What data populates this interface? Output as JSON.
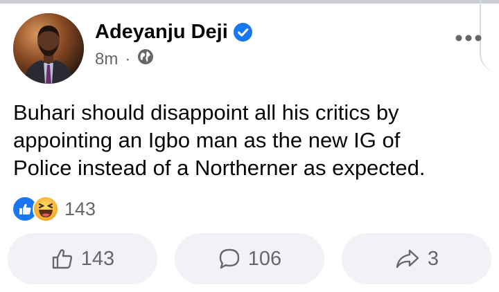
{
  "post": {
    "author": "Adeyanju Deji",
    "time": "8m",
    "separator": "·",
    "text": "Buhari should disappoint all his critics by\nappointing an Igbo man as the new IG of\nPolice instead of a Northerner as expected.",
    "reaction_count": "143",
    "reaction_icons": [
      "like-icon",
      "haha-icon"
    ]
  },
  "actions": {
    "like_count": "143",
    "comment_count": "106",
    "share_count": "3"
  },
  "colors": {
    "verified_blue": "#1877f2",
    "button_bg": "#f0f2f5",
    "meta_gray": "#65676b"
  }
}
